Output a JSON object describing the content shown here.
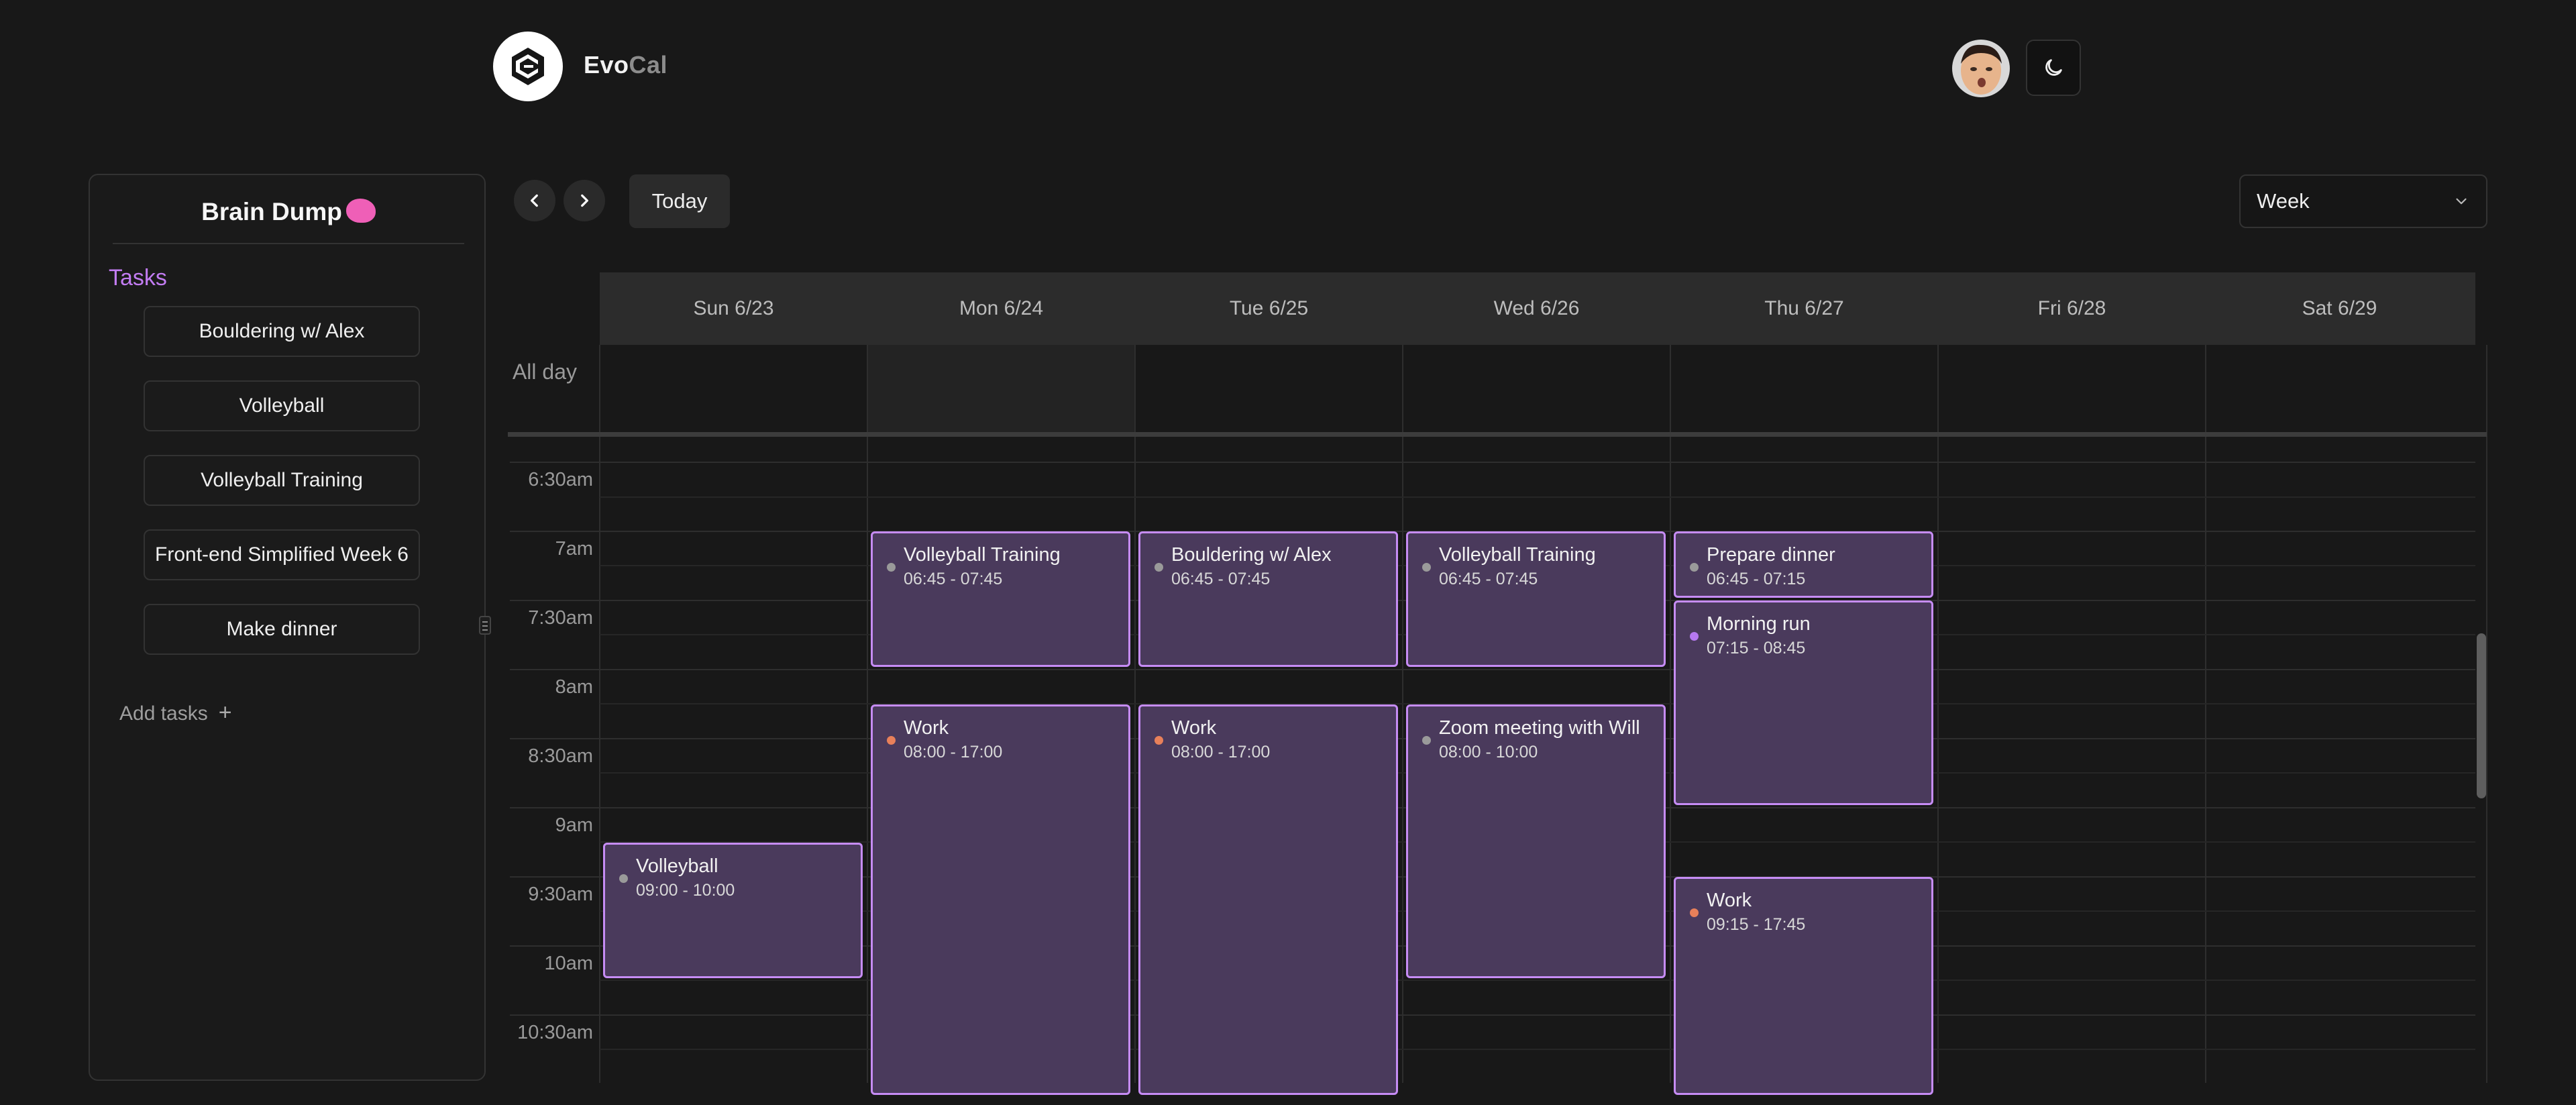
{
  "brand": {
    "name_part1": "Evo",
    "name_part2": "Cal"
  },
  "header": {
    "theme_toggle_icon": "moon-icon",
    "avatar_icon": "avatar"
  },
  "sidebar": {
    "title": "Brain Dump",
    "tasks_label": "Tasks",
    "tasks": [
      "Bouldering w/ Alex",
      "Volleyball",
      "Volleyball Training",
      "Front-end Simplified Week 6",
      "Make dinner"
    ],
    "add_tasks_label": "Add tasks",
    "add_icon": "plus-icon"
  },
  "toolbar": {
    "today_label": "Today",
    "view_value": "Week",
    "prev_icon": "chevron-left-icon",
    "next_icon": "chevron-right-icon"
  },
  "calendar": {
    "all_day_label": "All day",
    "days": [
      "Sun 6/23",
      "Mon 6/24",
      "Tue 6/25",
      "Wed 6/26",
      "Thu 6/27",
      "Fri 6/28",
      "Sat 6/29"
    ],
    "time_labels": [
      "6:30am",
      "7am",
      "7:30am",
      "8am",
      "8:30am",
      "9am",
      "9:30am",
      "10am",
      "10:30am"
    ],
    "events": [
      {
        "day": 0,
        "start": "09:00",
        "end": "10:00",
        "title": "Volleyball",
        "time": "09:00 - 10:00",
        "dot": "#9a9a9a"
      },
      {
        "day": 1,
        "start": "06:45",
        "end": "07:45",
        "title": "Volleyball Training",
        "time": "06:45 - 07:45",
        "dot": "#9a9a9a"
      },
      {
        "day": 1,
        "start": "08:00",
        "end": "17:00",
        "title": "Work",
        "time": "08:00 - 17:00",
        "dot": "#e8805a"
      },
      {
        "day": 2,
        "start": "06:45",
        "end": "07:45",
        "title": "Bouldering w/ Alex",
        "time": "06:45 - 07:45",
        "dot": "#9a9a9a"
      },
      {
        "day": 2,
        "start": "08:00",
        "end": "17:00",
        "title": "Work",
        "time": "08:00 - 17:00",
        "dot": "#e8805a"
      },
      {
        "day": 3,
        "start": "06:45",
        "end": "07:45",
        "title": "Volleyball Training",
        "time": "06:45 - 07:45",
        "dot": "#9a9a9a"
      },
      {
        "day": 3,
        "start": "08:00",
        "end": "10:00",
        "title": "Zoom meeting with Will",
        "time": "08:00 - 10:00",
        "dot": "#9a9a9a"
      },
      {
        "day": 4,
        "start": "06:45",
        "end": "07:15",
        "title": "Prepare dinner",
        "time": "06:45 - 07:15",
        "dot": "#9a9a9a"
      },
      {
        "day": 4,
        "start": "07:15",
        "end": "08:45",
        "title": "Morning run",
        "time": "07:15 - 08:45",
        "dot": "#b679f0"
      },
      {
        "day": 4,
        "start": "09:15",
        "end": "17:45",
        "title": "Work",
        "time": "09:15 - 17:45",
        "dot": "#e8805a"
      }
    ]
  },
  "colors": {
    "accent": "#c07cf0",
    "event_fill": "#4a3a5c",
    "event_border": "#c68cf5",
    "work_dot": "#e8805a"
  }
}
